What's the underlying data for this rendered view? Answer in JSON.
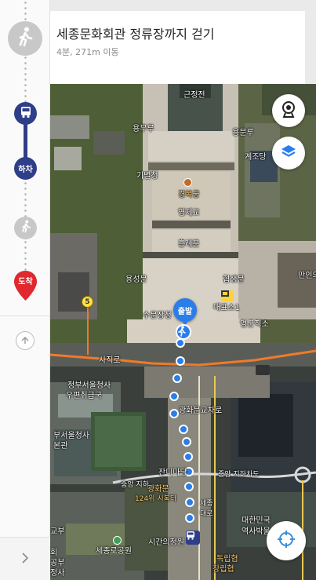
{
  "header": {
    "title": "세종문화회관 정류장까지 걷기",
    "subtitle": "4분, 271m 이동"
  },
  "timeline": {
    "alight_label": "하차",
    "arrive_label": "도착"
  },
  "map": {
    "start_label": "출발",
    "subway_line_number": "5",
    "labels": {
      "geunjeongjeon": "근정전",
      "yongmuru": "용무루",
      "yongmunnu": "용문루",
      "gyejodang": "계조당",
      "gibyeolcheong": "기별청",
      "gyeongbokgung": "경복궁",
      "yeongjegyo": "영제교",
      "heungnyemun": "흥례문",
      "yongseongmun": "용성문",
      "hyeopsaengmun": "협생문",
      "maepyoso": "매표소1",
      "sumunjangcheong": "수문장청",
      "yeonggunjikso": "영군직소",
      "manin": "만인의",
      "sajikro": "사직로",
      "gov_complex": "정부서울청사",
      "post_office": "우편취급국",
      "gov_complex2": "부서울청사",
      "bonkwan": "본관",
      "gwanghwamun_crossroad": "광화문교차로",
      "jandi_madang": "잔디마당",
      "jungang_underpass": "중앙 지하차도",
      "jungang_ji": "중앙 지하",
      "gwanghwamun": "광화문",
      "sebaekti": "124위 시복터",
      "sejongno": "세종",
      "sejongno2": "대로",
      "sigan": "시간의정원",
      "sejongro_park": "세종로공원",
      "korea_assoc": "대한민국",
      "history_museum": "역사박물",
      "dongnip": "독립협",
      "changip": "창립협",
      "gyobu": "교부",
      "hoegwan": "회",
      "gongbu": "공부",
      "jeongsa": "정사"
    }
  },
  "colors": {
    "route_blue": "#2b7de9",
    "bus_navy": "#2f3e88",
    "arrive_red": "#e0282e",
    "road_orange": "#f07a2a"
  },
  "icons": [
    "walk-icon",
    "bus-icon",
    "pin-icon",
    "cctv-icon",
    "layers-icon",
    "locate-icon",
    "arrow-up-icon",
    "chevron-right-icon"
  ]
}
